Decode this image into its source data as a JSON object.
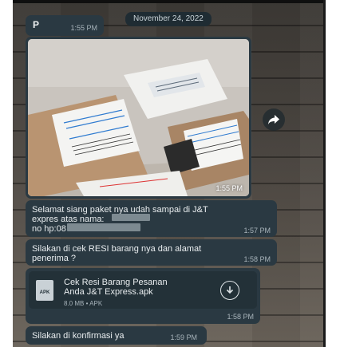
{
  "chat": {
    "date_separator": "November 24, 2022",
    "messages": [
      {
        "sender": "P",
        "time": "1:55 PM"
      },
      {
        "type": "image",
        "time": "1:55 PM"
      },
      {
        "lines": [
          "Selamat siang paket nya udah sampai di J&T",
          "expres atas nama:",
          "no hp:08"
        ],
        "time": "1:57 PM"
      },
      {
        "lines": [
          "Silakan di cek RESI barang nya dan alamat",
          "penerima ?"
        ],
        "time": "1:58 PM"
      },
      {
        "type": "file",
        "file_name_lines": [
          "Cek Resi Barang Pesanan",
          "Anda J&T Express.apk"
        ],
        "file_meta": "8.0 MB • APK",
        "file_badge": "APK",
        "time": "1:58 PM"
      },
      {
        "text": "Silakan di konfirmasi ya",
        "time": "1:59 PM"
      }
    ]
  },
  "icons": {
    "share": "share-arrow-icon",
    "download": "download-icon",
    "file": "apk-file-icon"
  },
  "colors": {
    "bubble": "#2a3942",
    "date_chip": "#1f2c33",
    "text": "#e9edef",
    "timestamp": "#a7b3ba"
  }
}
